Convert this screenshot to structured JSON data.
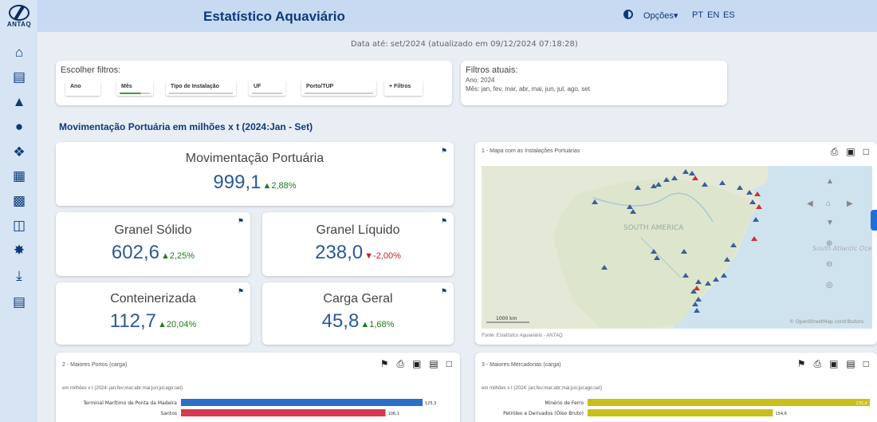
{
  "header": {
    "logo_text": "ANTAQ",
    "title": "Estatístico Aquaviário",
    "options_label": "Opções▾",
    "languages": [
      "PT",
      "EN",
      "ES"
    ]
  },
  "sidebar": {
    "icons": [
      "home-icon",
      "terminal-icon",
      "ship-icon",
      "globe-icon",
      "brazil-map-icon",
      "regions-icon",
      "tku-icon",
      "cargo-icon",
      "bulb-icon",
      "download-icon",
      "book-icon"
    ]
  },
  "date_line": "Data até: set/2024 (atualizado em 09/12/2024 07:18:28)",
  "filters": {
    "label": "Escolher filtros:",
    "chips": [
      "Ano",
      "Mês",
      "Tipo de Instalação",
      "UF",
      "Porto/TUP",
      "+ Filtros"
    ]
  },
  "current_filters": {
    "label": "Filtros atuais:",
    "year_line": "Ano: 2024",
    "month_line": "Mês: jan, fev, mar, abr, mai, jun, jul, ago, set"
  },
  "section_title": "Movimentação Portuária em milhões x t (2024:Jan - Set)",
  "kpis": {
    "total": {
      "title": "Movimentação Portuária",
      "value": "999,1",
      "change": "▲2,88%"
    },
    "solid": {
      "title": "Granel Sólido",
      "value": "602,6",
      "change": "▲2,25%"
    },
    "liquid": {
      "title": "Granel Líquido",
      "value": "238,0",
      "change": "▼-2,00%"
    },
    "container": {
      "title": "Conteinerizada",
      "value": "112,7",
      "change": "▲20,04%"
    },
    "general": {
      "title": "Carga Geral",
      "value": "45,8",
      "change": "▲1,68%"
    }
  },
  "map": {
    "title": "1 - Mapa com as Instalações Portuárias",
    "region_label": "SOUTH AMERICA",
    "ocean_label": "South Atlantic Oce",
    "scale": "1000 km",
    "attribution": "© OpenStreetMap contributors",
    "source": "Fonte: Estatístico Aquaviário - ANTAQ."
  },
  "ports_chart": {
    "title": "2 - Maiores Portos (carga)",
    "subtitle": "em milhões x t (2024: jan;fev;mar;abr;mai;jun;jul;ago;set)"
  },
  "goods_chart": {
    "title": "3 - Maiores Mercadorias (carga)",
    "subtitle": "em milhões x t (2024: jan;fev;mar;abr;mai;jun;jul;ago;set)"
  },
  "chart_data": [
    {
      "type": "bar",
      "title": "2 - Maiores Portos (carga)",
      "categories": [
        "Terminal Marítimo de Ponta da Madeira",
        "Santos"
      ],
      "values": [
        125.3,
        106.1
      ],
      "value_labels": [
        "125,3",
        "106,1"
      ],
      "colors": [
        "#2a6fc9",
        "#d6394f"
      ]
    },
    {
      "type": "bar",
      "title": "3 - Maiores Mercadorias (carga)",
      "categories": [
        "Minério de Ferro",
        "Petróleo e Derivados (Óleo Bruto)"
      ],
      "values": [
        235.4,
        154.6
      ],
      "value_labels": [
        "235,4",
        "154,6"
      ],
      "colors": [
        "#c9bf1a",
        "#c9bf1a"
      ]
    }
  ]
}
